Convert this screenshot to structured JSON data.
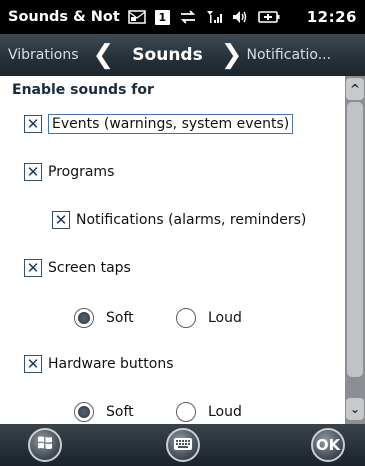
{
  "status_bar": {
    "app_title": "Sounds & Not",
    "box_label": "1",
    "time": "12:26"
  },
  "tab_header": {
    "prev": "Vibrations",
    "current": "Sounds",
    "next": "Notificatio..."
  },
  "content": {
    "section_title": "Enable sounds for",
    "options": {
      "events": {
        "label": "Events (warnings, system events)",
        "checked": true
      },
      "programs": {
        "label": "Programs",
        "checked": true
      },
      "notifications": {
        "label": "Notifications (alarms, reminders)",
        "checked": true
      },
      "screen_taps": {
        "label": "Screen taps",
        "checked": true
      },
      "hardware_buttons": {
        "label": "Hardware buttons",
        "checked": true
      }
    },
    "screen_tap_volume": {
      "soft": "Soft",
      "loud": "Loud",
      "selected": "Soft"
    },
    "hardware_volume": {
      "soft": "Soft",
      "loud": "Loud",
      "selected": "Soft"
    }
  },
  "bottom_bar": {
    "ok_label": "OK"
  }
}
